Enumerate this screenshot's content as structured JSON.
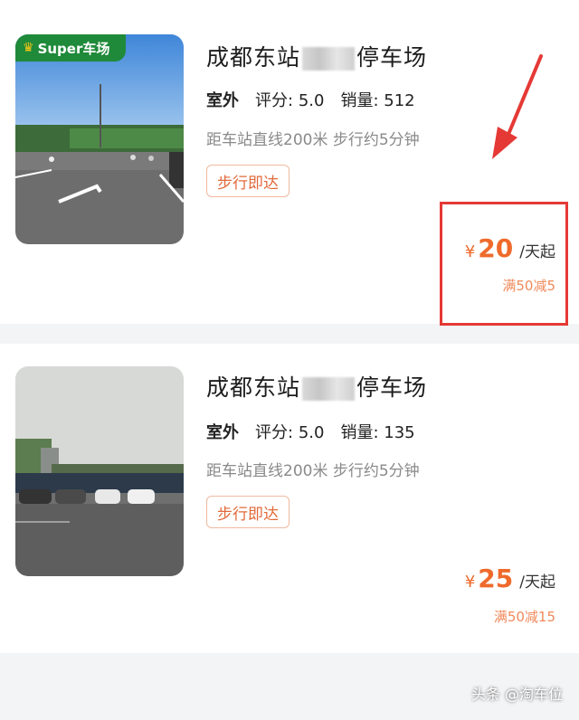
{
  "listings": [
    {
      "badge": "Super车场",
      "title_prefix": "成都东站",
      "title_suffix": "停车场",
      "tag": "室外",
      "rating_label": "评分:",
      "rating": "5.0",
      "sales_label": "销量:",
      "sales": "512",
      "distance": "距车站直线200米 步行约5分钟",
      "walk_label": "步行即达",
      "price_symbol": "¥",
      "price": "20",
      "price_unit": "/天起",
      "promo": "满50减5"
    },
    {
      "title_prefix": "成都东站",
      "title_suffix": "停车场",
      "tag": "室外",
      "rating_label": "评分:",
      "rating": "5.0",
      "sales_label": "销量:",
      "sales": "135",
      "distance": "距车站直线200米 步行约5分钟",
      "walk_label": "步行即达",
      "price_symbol": "¥",
      "price": "25",
      "price_unit": "/天起",
      "promo": "满50减15"
    }
  ],
  "watermark": "头条 @淘车位",
  "colors": {
    "accent": "#ef6a2b",
    "highlight": "#e53935",
    "badge_bg": "#1f8a3a"
  }
}
